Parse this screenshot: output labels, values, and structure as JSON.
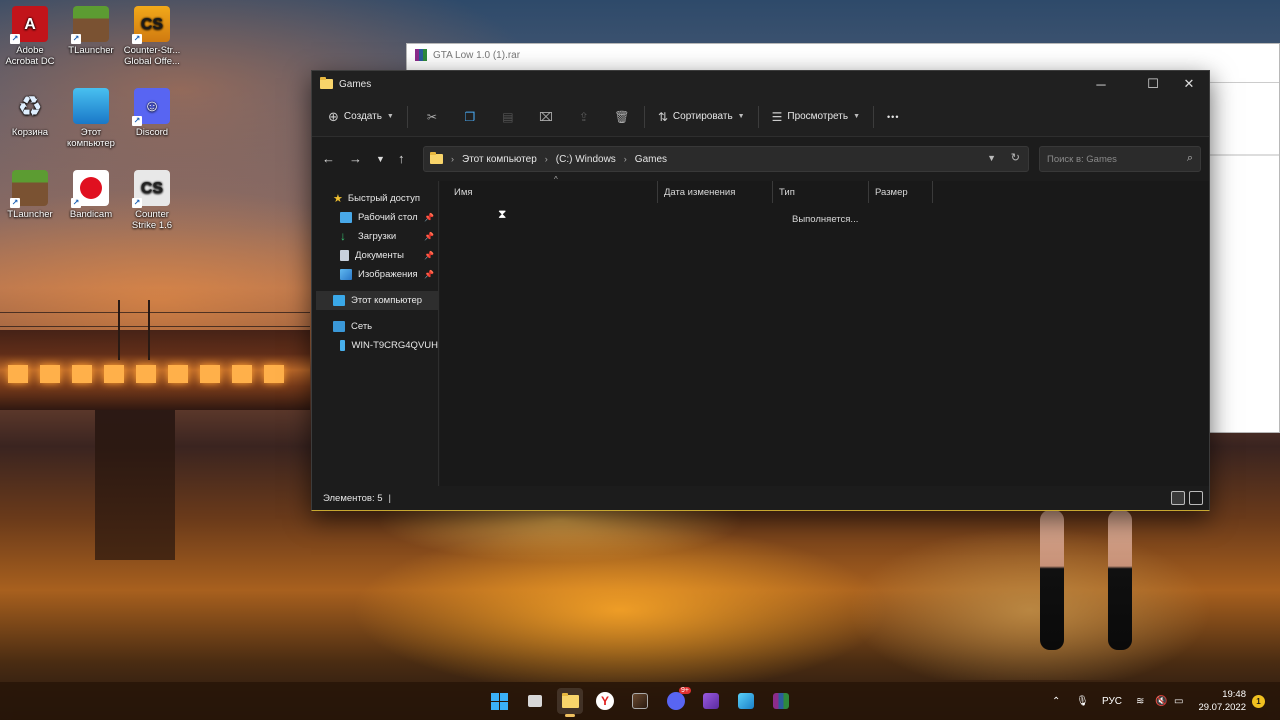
{
  "desktop": {
    "icons": [
      {
        "label_1": "Adobe",
        "label_2": "Acrobat DC",
        "glyph": "A"
      },
      {
        "label_1": "TLauncher",
        "label_2": "",
        "glyph": ""
      },
      {
        "label_1": "Counter-Str...",
        "label_2": "Global Offe...",
        "glyph": "CS"
      },
      {
        "label_1": "Корзина",
        "label_2": "",
        "glyph": "♻"
      },
      {
        "label_1": "Этот",
        "label_2": "компьютер",
        "glyph": ""
      },
      {
        "label_1": "Discord",
        "label_2": "",
        "glyph": "☺"
      },
      {
        "label_1": "TLauncher",
        "label_2": "",
        "glyph": ""
      },
      {
        "label_1": "Bandicam",
        "label_2": "",
        "glyph": ""
      },
      {
        "label_1": "Counter",
        "label_2": "Strike 1.6",
        "glyph": "CS"
      }
    ]
  },
  "background_window": {
    "title": "GTA Low 1.0 (1).rar"
  },
  "explorer": {
    "title": "Games",
    "toolbar": {
      "new_label": "Создать",
      "sort_label": "Сортировать",
      "view_label": "Просмотреть",
      "more_label": "•••"
    },
    "address": {
      "crumbs": [
        "Этот компьютер",
        "(C:) Windows",
        "Games"
      ]
    },
    "search": {
      "placeholder": "Поиск в: Games"
    },
    "sidebar": {
      "quick_access": "Быстрый доступ",
      "items": [
        {
          "label": "Рабочий стол",
          "pinned": true
        },
        {
          "label": "Загрузки",
          "pinned": true
        },
        {
          "label": "Документы",
          "pinned": true
        },
        {
          "label": "Изображения",
          "pinned": true
        }
      ],
      "this_pc": "Этот компьютер",
      "network": "Сеть",
      "network_host": "WIN-T9CRG4QVUH"
    },
    "columns": [
      "Имя",
      "Дата изменения",
      "Тип",
      "Размер"
    ],
    "loading_text": "Выполняется...",
    "status": "Элементов: 5"
  },
  "taskbar": {
    "discord_badge": "9+",
    "language": "РУС",
    "time": "19:48",
    "date": "29.07.2022",
    "notification_count": "1"
  },
  "colors": {
    "explorer_bg": "#1c1c1c",
    "folder_yellow": "#f8d46a",
    "accent_border": "#c8a830",
    "taskbar": "#28160a"
  }
}
